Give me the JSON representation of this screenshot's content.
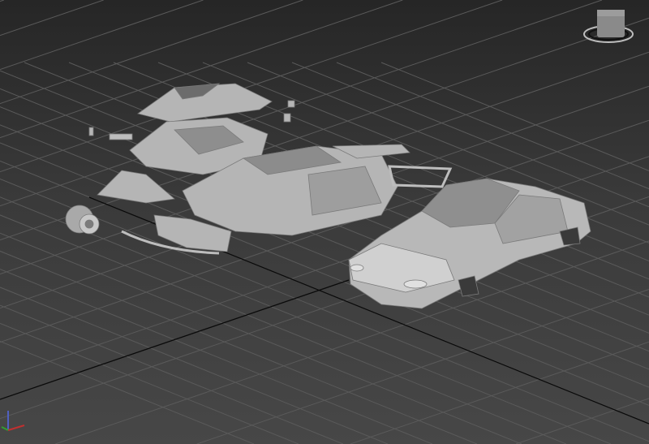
{
  "viewport": {
    "colors": {
      "grid": "#555555",
      "axis": "#0a0a0a",
      "model": "#b8b8b8",
      "model_shadow": "#8a8a8a"
    },
    "icons": {
      "viewcube": "viewcube-icon",
      "gizmo": "axis-gizmo-icon"
    }
  }
}
